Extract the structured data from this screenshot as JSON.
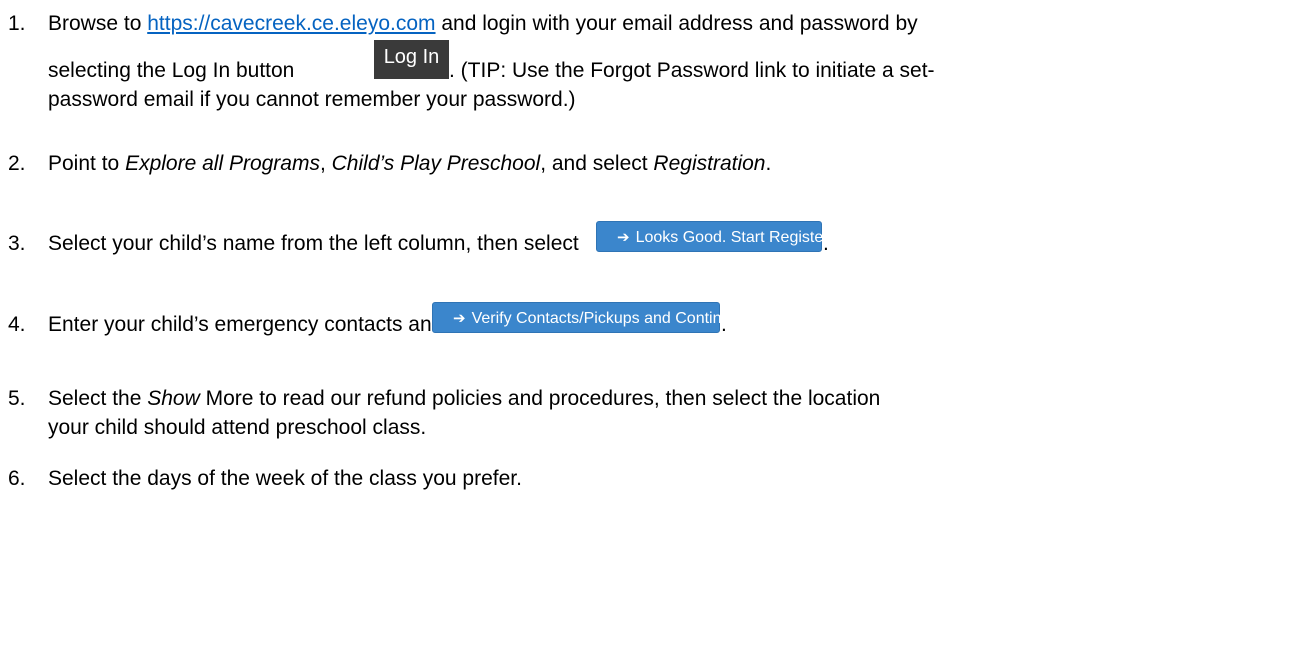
{
  "steps": [
    {
      "number": "1.",
      "text_before": "Browse to ",
      "link": "https://cavecreek.ce.eleyo.com",
      "text_after": " and login with your email address and password by",
      "line2_before": "selecting the Log In button",
      "button_label": "Log In",
      "line2_after": ". (TIP: Use the Forgot Password link to initiate a set-",
      "line3": "password email if you cannot remember your password.)"
    },
    {
      "number": "2.",
      "pre": "Point to ",
      "em1": "Explore all Programs",
      "sep1": ", ",
      "em2": "Child’s Play Preschool",
      "sep2": ", and select ",
      "em3": "Registration",
      "end": "."
    },
    {
      "number": "3.",
      "text": "Select your child’s name from the left column, then select",
      "button_label": "Looks Good. Start Registering.",
      "end": "."
    },
    {
      "number": "4.",
      "text": "Enter your child’s emergency contacts and",
      "button_label": "Verify Contacts/Pickups and Continue",
      "end": "."
    },
    {
      "number": "5.",
      "pre": "Select the ",
      "em": "Show",
      "rest": " More to read our refund policies and procedures, then select the location",
      "line2": "your child should attend preschool class."
    },
    {
      "number": "6.",
      "text": "Select the days of the week of the class you prefer."
    }
  ],
  "icons": {
    "arrow": "arrow-right-icon"
  },
  "colors": {
    "link": "#0563c1",
    "button_blue": "#3b86cc",
    "login_button": "#3a3a3a"
  }
}
